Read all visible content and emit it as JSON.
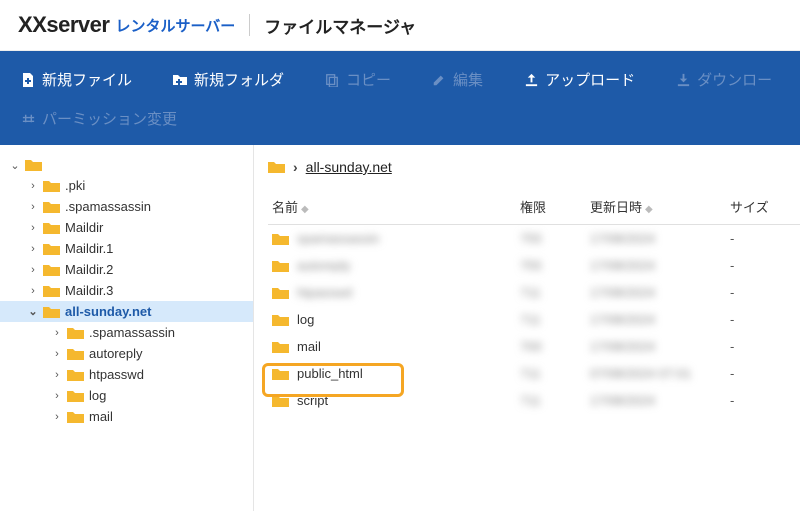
{
  "header": {
    "logo_main": "Xserver",
    "logo_sub": "レンタルサーバー",
    "app_title": "ファイルマネージャ"
  },
  "toolbar": {
    "new_file": "新規ファイル",
    "new_folder": "新規フォルダ",
    "copy": "コピー",
    "edit": "編集",
    "upload": "アップロード",
    "download": "ダウンロー",
    "permission": "パーミッション変更"
  },
  "tree": {
    "root": "",
    "items": [
      {
        "label": ".pki",
        "indent": 1,
        "expanded": false
      },
      {
        "label": ".spamassassin",
        "indent": 1,
        "expanded": false
      },
      {
        "label": "Maildir",
        "indent": 1,
        "expanded": false
      },
      {
        "label": "Maildir.1",
        "indent": 1,
        "expanded": false
      },
      {
        "label": "Maildir.2",
        "indent": 1,
        "expanded": false
      },
      {
        "label": "Maildir.3",
        "indent": 1,
        "expanded": false
      },
      {
        "label": "all-sunday.net",
        "indent": 1,
        "expanded": true,
        "active": true
      },
      {
        "label": ".spamassassin",
        "indent": 2,
        "expanded": false
      },
      {
        "label": "autoreply",
        "indent": 2,
        "expanded": false
      },
      {
        "label": "htpasswd",
        "indent": 2,
        "expanded": false
      },
      {
        "label": "log",
        "indent": 2,
        "expanded": false
      },
      {
        "label": "mail",
        "indent": 2,
        "expanded": false
      }
    ]
  },
  "breadcrumb": {
    "current": "all-sunday.net"
  },
  "columns": {
    "name": "名前",
    "perm": "権限",
    "mod": "更新日時",
    "size": "サイズ"
  },
  "rows": [
    {
      "name": "spamassassin",
      "perm": "755",
      "mod": "17/08/2024",
      "size": "-",
      "blur": true
    },
    {
      "name": "autoreply",
      "perm": "755",
      "mod": "17/08/2024",
      "size": "-",
      "blur": true
    },
    {
      "name": "htpasswd",
      "perm": "711",
      "mod": "17/08/2024",
      "size": "-",
      "blur": true
    },
    {
      "name": "log",
      "perm": "711",
      "mod": "17/08/2024",
      "size": "-",
      "blur_meta": true
    },
    {
      "name": "mail",
      "perm": "700",
      "mod": "17/08/2024",
      "size": "-",
      "blur_meta": true
    },
    {
      "name": "public_html",
      "perm": "711",
      "mod": "07/08/2024 07:01",
      "size": "-",
      "highlight": true,
      "blur_meta": true
    },
    {
      "name": "script",
      "perm": "711",
      "mod": "17/08/2024",
      "size": "-",
      "blur_meta": true
    }
  ]
}
